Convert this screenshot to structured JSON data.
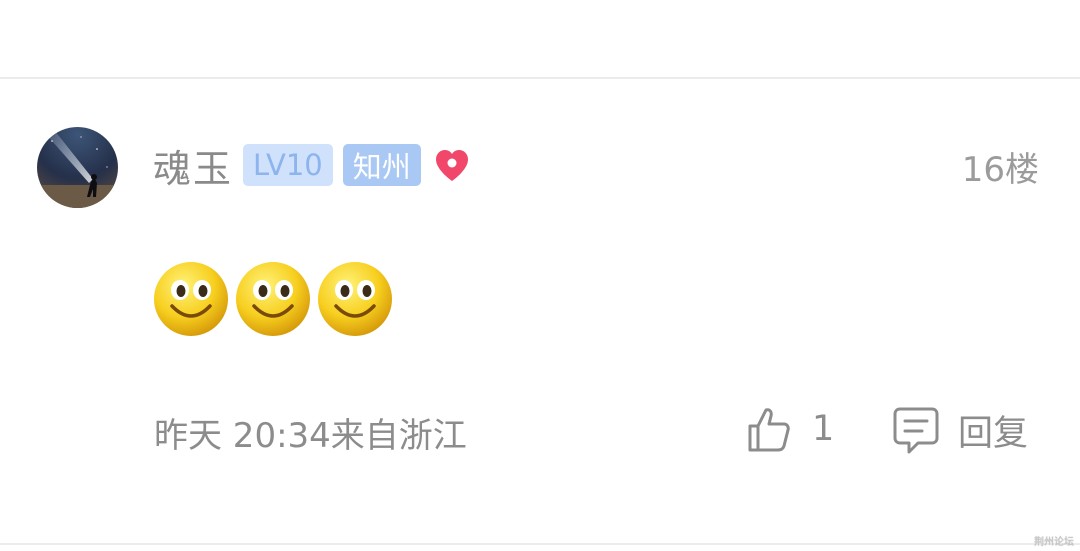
{
  "comment": {
    "username": "魂玉",
    "level_badge": "LV10",
    "region_badge": "知州",
    "floor": "16楼",
    "emojis": [
      "smiley-emoji",
      "smiley-emoji",
      "smiley-emoji"
    ],
    "time_location": "昨天 20:34来自浙江",
    "like_count": "1",
    "reply_label": "回复"
  },
  "watermark": "荆州论坛",
  "colors": {
    "level_badge_bg": "#cfe1fb",
    "region_badge_bg": "#a9c8f4",
    "heart": "#f0476a",
    "text_gray": "#8c8c8c"
  },
  "icons": [
    "heart-icon",
    "thumbs-up-icon",
    "comment-bubble-icon"
  ]
}
